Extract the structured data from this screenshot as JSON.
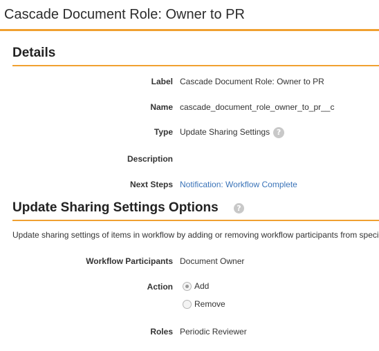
{
  "page": {
    "title": "Cascade Document Role: Owner to PR"
  },
  "details": {
    "heading": "Details",
    "fields": {
      "label": {
        "name": "Label",
        "value": "Cascade Document Role: Owner to PR"
      },
      "api_name": {
        "name": "Name",
        "value": "cascade_document_role_owner_to_pr__c"
      },
      "type": {
        "name": "Type",
        "value": "Update Sharing Settings",
        "icon": "help-icon"
      },
      "description": {
        "name": "Description",
        "value": ""
      },
      "next_steps": {
        "name": "Next Steps",
        "value": "Notification: Workflow Complete"
      }
    }
  },
  "options": {
    "heading": "Update Sharing Settings Options",
    "help_icon": "?",
    "description": "Update sharing settings of items in workflow by adding or removing workflow participants from speci",
    "workflow_participants": {
      "name": "Workflow Participants",
      "value": "Document Owner"
    },
    "action": {
      "name": "Action",
      "choices": [
        {
          "label": "Add",
          "selected": true
        },
        {
          "label": "Remove",
          "selected": false
        }
      ]
    },
    "roles": {
      "name": "Roles",
      "value": "Periodic Reviewer"
    }
  },
  "colors": {
    "accent_rule": "#f0a030",
    "link": "#3a73b8"
  }
}
